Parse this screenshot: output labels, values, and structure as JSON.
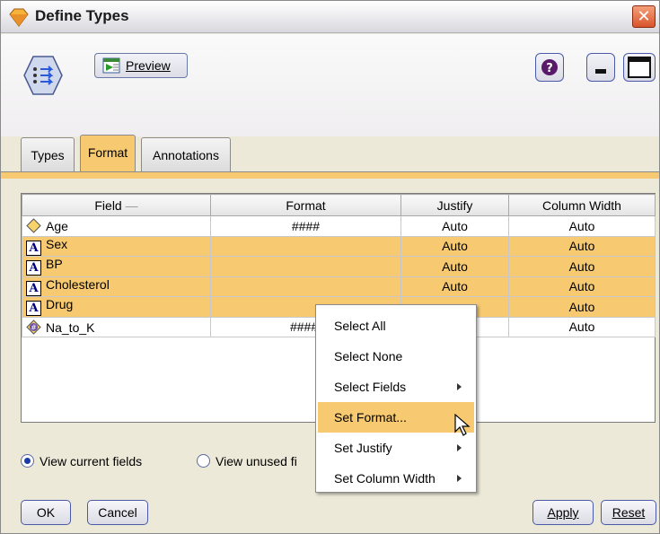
{
  "window": {
    "title": "Define Types"
  },
  "toolbar": {
    "preview_label": "Preview"
  },
  "tabs": [
    {
      "label": "Types"
    },
    {
      "label": "Format"
    },
    {
      "label": "Annotations"
    }
  ],
  "table": {
    "columns": [
      "Field",
      "Format",
      "Justify",
      "Column Width"
    ],
    "rows": [
      {
        "field": "Age",
        "type_icon": "continuous-diamond-icon",
        "format": "####",
        "justify": "Auto",
        "width": "Auto",
        "selected": false
      },
      {
        "field": "Sex",
        "type_icon": "string-a-icon",
        "format": "",
        "justify": "Auto",
        "width": "Auto",
        "selected": true
      },
      {
        "field": "BP",
        "type_icon": "string-a-icon",
        "format": "",
        "justify": "Auto",
        "width": "Auto",
        "selected": true
      },
      {
        "field": "Cholesterol",
        "type_icon": "string-a-icon",
        "format": "",
        "justify": "Auto",
        "width": "Auto",
        "selected": true
      },
      {
        "field": "Drug",
        "type_icon": "string-a-icon",
        "format": "",
        "justify": "",
        "width": "Auto",
        "selected": true
      },
      {
        "field": "Na_to_K",
        "type_icon": "real-number-icon",
        "format": "####.",
        "justify": "",
        "width": "Auto",
        "selected": false
      }
    ]
  },
  "radio": {
    "current_label": "View current fields",
    "unused_label": "View unused fi"
  },
  "context_menu": {
    "items": [
      {
        "label": "Select All",
        "submenu": false
      },
      {
        "label": "Select None",
        "submenu": false
      },
      {
        "label": "Select Fields",
        "submenu": true
      },
      {
        "label": "Set Format...",
        "submenu": false,
        "highlighted": true
      },
      {
        "label": "Set Justify",
        "submenu": true
      },
      {
        "label": "Set Column Width",
        "submenu": true
      }
    ]
  },
  "buttons": {
    "ok": "OK",
    "cancel": "Cancel",
    "apply": "Apply",
    "reset": "Reset"
  },
  "colors": {
    "selection": "#f7c970",
    "accent_border": "#4a5aa8"
  }
}
